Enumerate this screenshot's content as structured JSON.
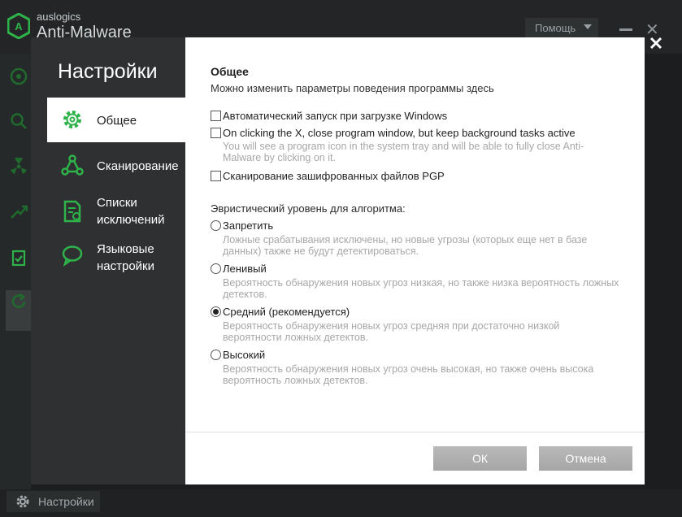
{
  "app": {
    "brand_small": "auslogics",
    "brand_name": "Anti-Malware",
    "help_label": "Помощь",
    "footer_settings_label": "Настройки"
  },
  "dialog": {
    "title": "Настройки",
    "nav": [
      {
        "label": "Общее",
        "icon": "gear-icon",
        "active": true
      },
      {
        "label": "Сканирование",
        "icon": "nodes-icon"
      },
      {
        "label": "Списки исключений",
        "icon": "document-check-icon"
      },
      {
        "label": "Языковые настройки",
        "icon": "speech-bubble-icon"
      }
    ],
    "general": {
      "title": "Общее",
      "subtitle": "Можно изменить параметры поведения программы здесь",
      "options": [
        {
          "label": "Автоматический запуск при загрузке Windows",
          "checked": false
        },
        {
          "label": "On clicking the X, close program window, but keep background tasks active",
          "checked": false,
          "description": "You will see a program icon in the system tray and will be able to fully close Anti-Malware by clicking on it."
        },
        {
          "label": "Сканирование зашифрованных файлов PGP",
          "checked": false
        }
      ],
      "heuristic_label": "Эвристический уровень для алгоритма:",
      "levels": [
        {
          "label": "Запретить",
          "selected": false,
          "description": "Ложные срабатывания исключены, но новые угрозы (которых еще нет в базе данных) также не будут детектироваться."
        },
        {
          "label": "Ленивый",
          "selected": false,
          "description": "Вероятность обнаружения новых угроз низкая, но также низка вероятность ложных детектов."
        },
        {
          "label": "Средний (рекомендуется)",
          "selected": true,
          "description": "Вероятность обнаружения новых угроз средняя при достаточно низкой вероятности ложных детектов."
        },
        {
          "label": "Высокий",
          "selected": false,
          "description": "Вероятность обнаружения новых угроз очень высокая, но также очень высока вероятность ложных детектов."
        }
      ]
    },
    "buttons": {
      "ok": "ОК",
      "cancel": "Отмена"
    }
  },
  "colors": {
    "accent": "#2eb34a",
    "sidebar": "#2e3031",
    "button": "#b2b2b2"
  }
}
